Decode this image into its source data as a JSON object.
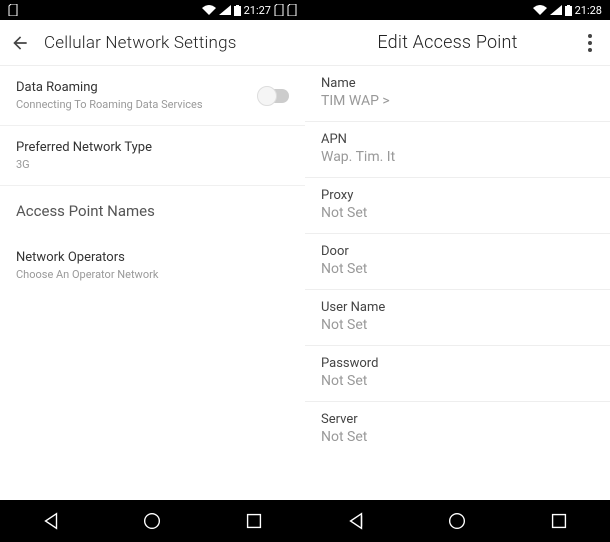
{
  "left": {
    "status": {
      "time": "21:27"
    },
    "title": "Cellular Network Settings",
    "roaming": {
      "label": "Data Roaming",
      "sub": "Connecting To Roaming Data Services"
    },
    "netType": {
      "label": "Preferred Network Type",
      "sub": "3G"
    },
    "apn": {
      "label": "Access Point Names"
    },
    "operators": {
      "label": "Network Operators",
      "sub": "Choose An Operator Network"
    }
  },
  "right": {
    "status": {
      "time": "21:28"
    },
    "title": "Edit Access Point",
    "fields": {
      "name": {
        "label": "Name",
        "value": "TIM WAP >"
      },
      "apn": {
        "label": "APN",
        "value": "Wap. Tim. It"
      },
      "proxy": {
        "label": "Proxy",
        "value": "Not Set"
      },
      "door": {
        "label": "Door",
        "value": "Not Set"
      },
      "user": {
        "label": "User Name",
        "value": "Not Set"
      },
      "pass": {
        "label": "Password",
        "value": "Not Set"
      },
      "server": {
        "label": "Server",
        "value": "Not Set"
      }
    }
  }
}
